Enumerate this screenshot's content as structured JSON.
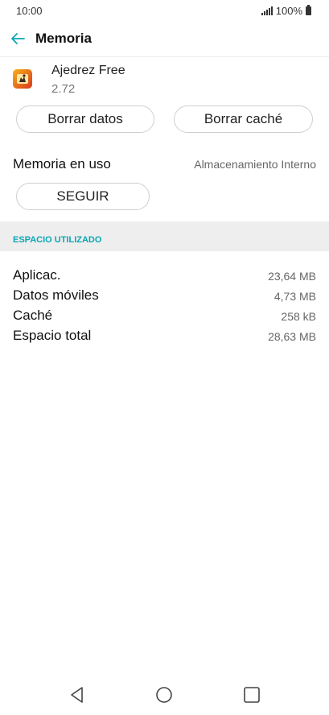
{
  "status_bar": {
    "time": "10:00",
    "battery": "100%"
  },
  "header": {
    "title": "Memoria"
  },
  "app": {
    "name": "Ajedrez Free",
    "version": "2.72"
  },
  "actions": {
    "clear_data": "Borrar datos",
    "clear_cache": "Borrar caché"
  },
  "storage": {
    "label": "Memoria en uso",
    "value": "Almacenamiento Interno",
    "continue_button": "SEGUIR"
  },
  "section": {
    "title": "ESPACIO UTILIZADO"
  },
  "usage": [
    {
      "label": "Aplicac.",
      "value": "23,64 MB"
    },
    {
      "label": "Datos móviles",
      "value": "4,73 MB"
    },
    {
      "label": "Caché",
      "value": "258 kB"
    },
    {
      "label": "Espacio total",
      "value": "28,63 MB"
    }
  ],
  "colors": {
    "accent": "#0ba6b5",
    "section_bg": "#eeeeee"
  }
}
